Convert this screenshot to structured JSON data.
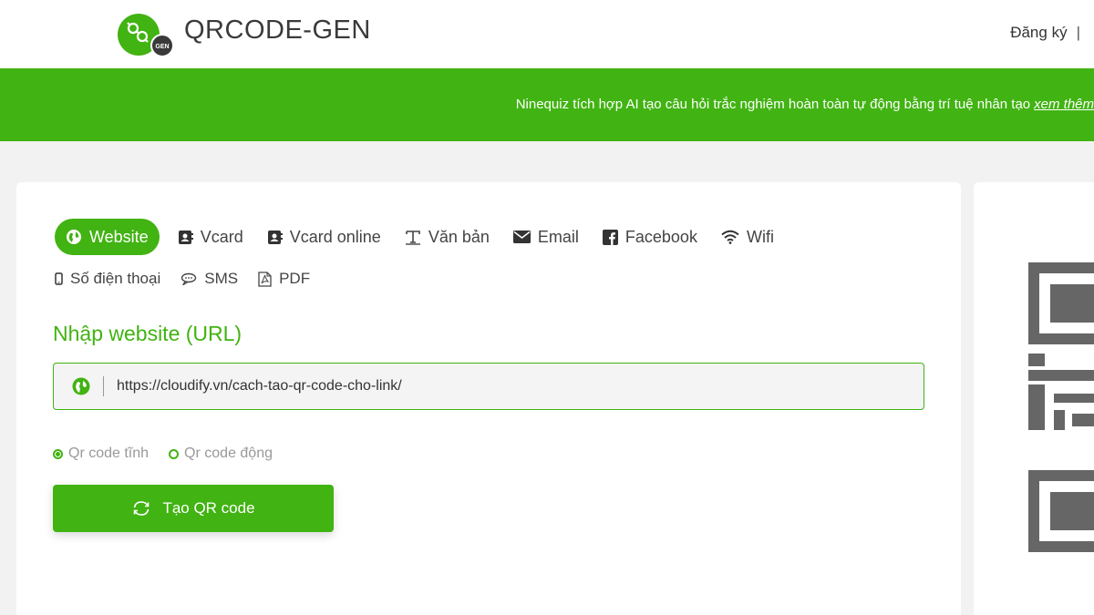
{
  "header": {
    "logo_badge": "GEN",
    "brand": "QRCODE-GEN",
    "register": "Đăng ký",
    "separator": "|"
  },
  "banner": {
    "text": "Ninequiz tích hợp AI tạo câu hỏi trắc nghiệm hoàn toàn tự động bằng trí tuệ nhân tạo",
    "link": "xem thêm"
  },
  "tabs": [
    {
      "label": "Website",
      "icon": "globe-icon",
      "active": true
    },
    {
      "label": "Vcard",
      "icon": "contact-card-icon"
    },
    {
      "label": "Vcard online",
      "icon": "contact-card-icon"
    },
    {
      "label": "Văn bản",
      "icon": "text-icon"
    },
    {
      "label": "Email",
      "icon": "envelope-icon"
    },
    {
      "label": "Facebook",
      "icon": "facebook-icon"
    },
    {
      "label": "Wifi",
      "icon": "wifi-icon"
    },
    {
      "label": "Số điện thoại",
      "icon": "phone-icon"
    },
    {
      "label": "SMS",
      "icon": "chat-icon"
    },
    {
      "label": "PDF",
      "icon": "pdf-icon"
    }
  ],
  "form": {
    "title": "Nhập website (URL)",
    "url_value": "https://cloudify.vn/cach-tao-qr-code-cho-link/",
    "radio_static": "Qr code tĩnh",
    "radio_dynamic": "Qr code động",
    "selected": "static",
    "submit": "Tạo QR code"
  },
  "colors": {
    "accent": "#41b312",
    "dark_logo": "#3a3a3a"
  }
}
